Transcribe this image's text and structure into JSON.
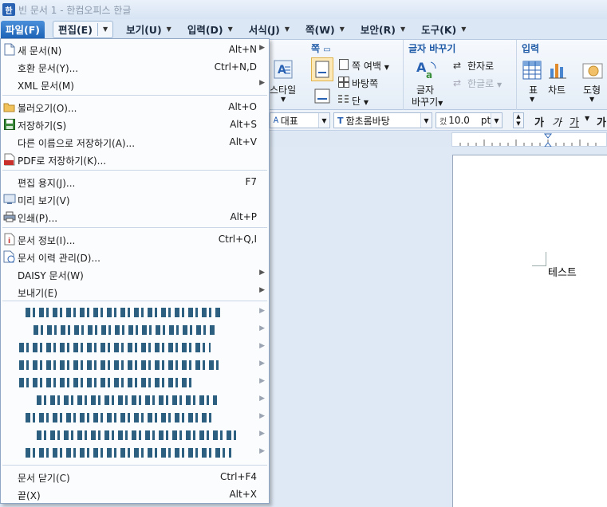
{
  "window": {
    "title": "빈 문서 1 - 한컴오피스 한글",
    "app_icon_glyph": "한"
  },
  "menubar": {
    "tabs": [
      {
        "label": "파일(F)"
      },
      {
        "label": "편집(E)"
      },
      {
        "label": "보기(U)"
      },
      {
        "label": "입력(D)"
      },
      {
        "label": "서식(J)"
      },
      {
        "label": "쪽(W)"
      },
      {
        "label": "보안(R)"
      },
      {
        "label": "도구(K)"
      }
    ]
  },
  "ribbon": {
    "style_label": "스타일",
    "page_group": {
      "title": "쪽",
      "margin": "쪽 여백",
      "background": "바탕쪽",
      "column": "단"
    },
    "text_replace_group": {
      "title": "글자 바꾸기",
      "replace_line1": "글자",
      "replace_line2": "바꾸기",
      "to_hanja": "한자로",
      "to_hangul": "한글로"
    },
    "input_group": {
      "title": "입력",
      "table": "표",
      "chart": "차트",
      "shape": "도형"
    }
  },
  "format_toolbar": {
    "style_combo": "대표",
    "font_combo": "함초롬바탕",
    "size_combo": "10.0",
    "size_unit": "pt",
    "bold": "가",
    "italic": "가",
    "underline": "가",
    "strike": "가"
  },
  "document": {
    "text": "테스트"
  },
  "file_menu": {
    "items": [
      {
        "label": "새 문서(N)",
        "shortcut": "Alt+N",
        "submenu": true,
        "icon": "new-document-icon"
      },
      {
        "label": "호환 문서(Y)...",
        "shortcut": "Ctrl+N,D",
        "submenu": false,
        "icon": ""
      },
      {
        "label": "XML 문서(M)",
        "shortcut": "",
        "submenu": true,
        "icon": ""
      },
      {
        "label": "불러오기(O)...",
        "shortcut": "Alt+O",
        "submenu": false,
        "icon": "open-folder-icon"
      },
      {
        "label": "저장하기(S)",
        "shortcut": "Alt+S",
        "submenu": false,
        "icon": "save-icon"
      },
      {
        "label": "다른 이름으로 저장하기(A)...",
        "shortcut": "Alt+V",
        "submenu": false,
        "icon": ""
      },
      {
        "label": "PDF로 저장하기(K)...",
        "shortcut": "",
        "submenu": false,
        "icon": "pdf-icon"
      },
      {
        "label": "편집 용지(J)...",
        "shortcut": "F7",
        "submenu": false,
        "icon": ""
      },
      {
        "label": "미리 보기(V)",
        "shortcut": "",
        "submenu": false,
        "icon": "preview-icon"
      },
      {
        "label": "인쇄(P)...",
        "shortcut": "Alt+P",
        "submenu": false,
        "icon": "print-icon"
      },
      {
        "label": "문서 정보(I)...",
        "shortcut": "Ctrl+Q,I",
        "submenu": false,
        "icon": "document-info-icon"
      },
      {
        "label": "문서 이력 관리(D)...",
        "shortcut": "",
        "submenu": false,
        "icon": "history-icon"
      },
      {
        "label": "DAISY 문서(W)",
        "shortcut": "",
        "submenu": true,
        "icon": ""
      },
      {
        "label": "보내기(E)",
        "shortcut": "",
        "submenu": true,
        "icon": ""
      },
      {
        "label": "문서 닫기(C)",
        "shortcut": "Ctrl+F4",
        "submenu": false,
        "icon": ""
      },
      {
        "label": "끝(X)",
        "shortcut": "Alt+X",
        "submenu": false,
        "icon": ""
      }
    ]
  }
}
